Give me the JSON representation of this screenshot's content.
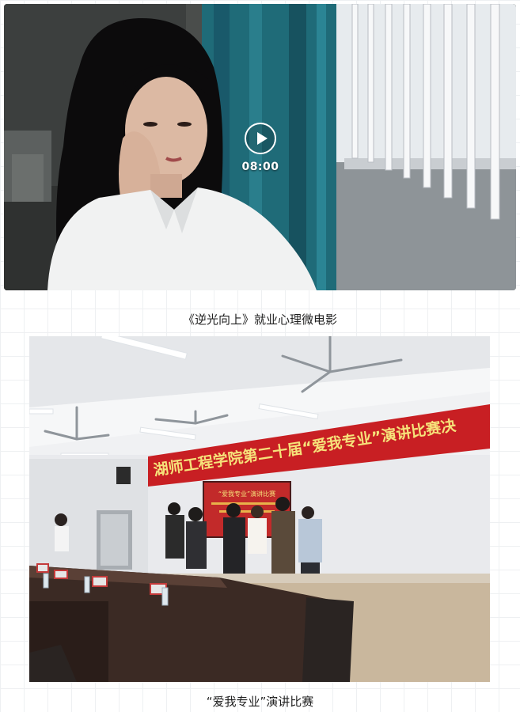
{
  "video": {
    "duration": "08:00",
    "play_icon": "play-icon",
    "caption": "《逆光向上》就业心理微电影"
  },
  "photo": {
    "banner_text": "湖师工程学院第二十届“爱我专业”演讲比赛决",
    "screen_text_line1": "“爱我专业”演讲比赛",
    "caption": "“爱我专业”演讲比赛"
  },
  "colors": {
    "banner_red": "#c81f23",
    "banner_text": "#f6e27a",
    "teal_curtain": "#1f6b78",
    "wall": "#ecedf0",
    "table": "#3b2a24"
  }
}
